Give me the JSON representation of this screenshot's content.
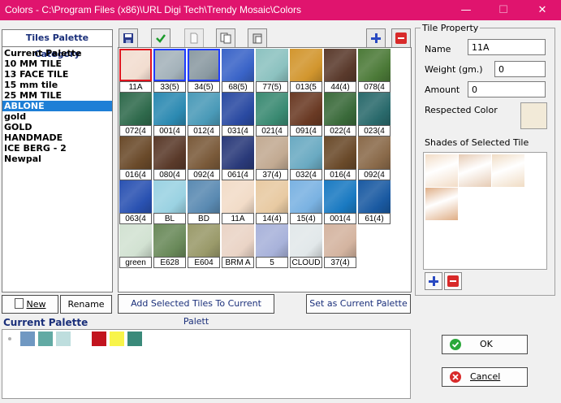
{
  "window": {
    "title": "Colors - C:\\Program Files (x86)\\URL Digi Tech\\Trendy Mosaic\\Colors",
    "minimize": "—",
    "maximize": "☐",
    "close": "✕"
  },
  "category_panel": {
    "header": "Tiles Palette Category",
    "items": [
      "Current Palette",
      "10 MM TILE",
      "13 FACE TILE",
      "15 mm tile",
      "25 MM TILE",
      "ABLONE",
      "gold",
      "GOLD",
      "HANDMADE",
      "ICE BERG - 2",
      "Newpal"
    ],
    "selected_index": 5,
    "new_label": "New",
    "rename_label": "Rename"
  },
  "toolbar": {
    "save_icon": "save-icon",
    "check_icon": "check-icon",
    "new_doc_icon": "new-document-icon",
    "copy_icon": "copy-icon",
    "paste_icon": "paste-icon",
    "add_icon": "plus-icon",
    "remove_icon": "minus-icon"
  },
  "tiles": [
    {
      "label": "11A",
      "color": "#f2ddd0",
      "sel": "red"
    },
    {
      "label": "33(5)",
      "color": "#a4b2ba",
      "sel": "blue"
    },
    {
      "label": "34(5)",
      "color": "#8b9aa2",
      "sel": "blue"
    },
    {
      "label": "68(5)",
      "color": "#3a64c8"
    },
    {
      "label": "77(5)",
      "color": "#8cc2c0"
    },
    {
      "label": "013(5",
      "color": "#d2962e"
    },
    {
      "label": "44(4)",
      "color": "#5a3a2c"
    },
    {
      "label": "078(4",
      "color": "#4c7a38"
    },
    {
      "label": "072(4",
      "color": "#2f6a4c"
    },
    {
      "label": "001(4",
      "color": "#2c8ab2"
    },
    {
      "label": "012(4",
      "color": "#4a9ab8"
    },
    {
      "label": "031(4",
      "color": "#2a4aa2"
    },
    {
      "label": "021(4",
      "color": "#3a8a72"
    },
    {
      "label": "091(4",
      "color": "#6a3a24"
    },
    {
      "label": "022(4",
      "color": "#3a6a3a"
    },
    {
      "label": "023(4",
      "color": "#2a6a6c"
    },
    {
      "label": "016(4",
      "color": "#6a4a2a"
    },
    {
      "label": "080(4",
      "color": "#5a3a2a"
    },
    {
      "label": "092(4",
      "color": "#7a5a3a"
    },
    {
      "label": "061(4",
      "color": "#2a3a7a"
    },
    {
      "label": "37(4)",
      "color": "#c2aa92"
    },
    {
      "label": "032(4",
      "color": "#6aaac2"
    },
    {
      "label": "016(4",
      "color": "#6a4a2a"
    },
    {
      "label": "092(4",
      "color": "#8a6a4a"
    },
    {
      "label": "063(4",
      "color": "#2a52b2"
    },
    {
      "label": "BL",
      "color": "#9ad2e2"
    },
    {
      "label": "BD",
      "color": "#5a8ab2"
    },
    {
      "label": "11A",
      "color": "#f2dcc8"
    },
    {
      "label": "14(4)",
      "color": "#e8caa2"
    },
    {
      "label": "15(4)",
      "color": "#7ab2e2"
    },
    {
      "label": "001(4",
      "color": "#1a7ac2"
    },
    {
      "label": "61(4)",
      "color": "#1a5aa2"
    },
    {
      "label": "green",
      "color": "#d2e2d2"
    },
    {
      "label": "E628",
      "color": "#6a8a5a"
    },
    {
      "label": "E604",
      "color": "#9a9a6a"
    },
    {
      "label": "BRM A",
      "color": "#ead4c6"
    },
    {
      "label": "5",
      "color": "#a8b2da"
    },
    {
      "label": "CLOUD",
      "color": "#e2e8ea"
    },
    {
      "label": "37(4)",
      "color": "#d4b4a0"
    }
  ],
  "actions": {
    "add_selected": "Add Selected Tiles To Current Palett",
    "set_current": "Set as Current Palette"
  },
  "tile_property": {
    "legend": "Tile Property",
    "name_label": "Name",
    "name_value": "11A",
    "weight_label": "Weight (gm.)",
    "weight_value": "0",
    "amount_label": "Amount",
    "amount_value": "0",
    "respected_label": "Respected Color",
    "respected_color": "#f2ead8",
    "shades_label": "Shades of Selected Tile",
    "shades": [
      "#f2dcc6",
      "#e6cbb4",
      "#f0dcc4",
      "#dfae86"
    ]
  },
  "current_palette": {
    "label": "Current Palette",
    "swatches": [
      "#7098c2",
      "#62aaa4",
      "#bedede",
      "#ffffff",
      "#c2141e",
      "#f8f44a",
      "#3a8a7a"
    ]
  },
  "dialog": {
    "ok_label": "OK",
    "cancel_label": "Cancel"
  }
}
